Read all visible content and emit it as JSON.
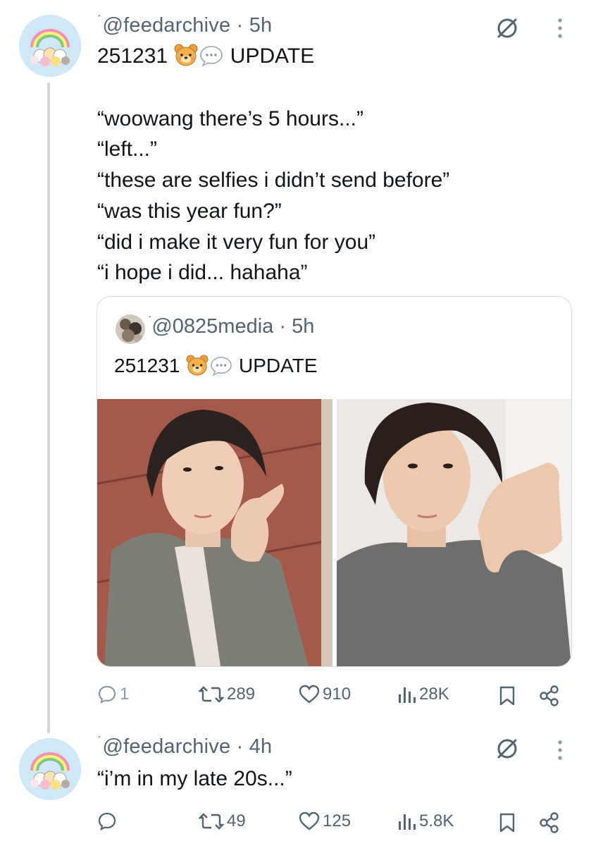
{
  "thread": [
    {
      "handle": "@feedarchive",
      "time": "5h",
      "lines": [
        "251231",
        "UPDATE",
        "“woowang there’s 5 hours...”",
        "“left...”",
        "“these are selfies i didn’t send before”",
        "“was this year fun?”",
        "“did i make it very fun for you”",
        "“i hope i did... hahaha”"
      ],
      "emoji": [
        "bear-face",
        "speech-bubble"
      ],
      "quote": {
        "handle": "@0825media",
        "time": "5h",
        "text_prefix": "251231",
        "text_suffix": "UPDATE",
        "emoji": [
          "bear-face",
          "speech-bubble"
        ],
        "photos": [
          "selfie-photo-1",
          "selfie-photo-2"
        ]
      },
      "actions": {
        "replies": "1",
        "reposts": "289",
        "likes": "910",
        "views": "28K"
      }
    },
    {
      "handle": "@feedarchive",
      "time": "4h",
      "text": "“i’m in my late 20s...”",
      "actions": {
        "replies": "",
        "reposts": "49",
        "likes": "125",
        "views": "5.8K"
      }
    }
  ],
  "colors": {
    "text": "#0f1419",
    "secondary": "#536471",
    "border": "#d6dde2",
    "avatar_bg": "#cfe8f7"
  }
}
